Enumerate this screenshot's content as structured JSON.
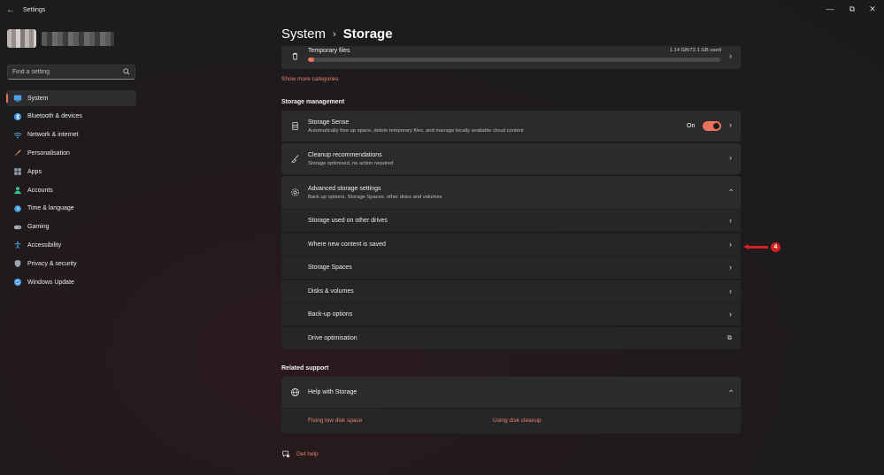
{
  "window": {
    "title": "Settings",
    "minimize": "—",
    "maximize": "⧉",
    "close": "✕"
  },
  "search": {
    "placeholder": "Find a setting"
  },
  "sidebar": {
    "items": [
      {
        "label": "System",
        "icon": "system-icon",
        "color": "#4aa3e8"
      },
      {
        "label": "Bluetooth & devices",
        "icon": "bluetooth-icon",
        "color": "#3b8ee0"
      },
      {
        "label": "Network & internet",
        "icon": "wifi-icon",
        "color": "#5aa8e6"
      },
      {
        "label": "Personalisation",
        "icon": "brush-icon",
        "color": "#e0a060"
      },
      {
        "label": "Apps",
        "icon": "apps-icon",
        "color": "#9aa3b0"
      },
      {
        "label": "Accounts",
        "icon": "person-icon",
        "color": "#3fc08a"
      },
      {
        "label": "Time & language",
        "icon": "globe-clock-icon",
        "color": "#4aa3e8"
      },
      {
        "label": "Gaming",
        "icon": "gamepad-icon",
        "color": "#aab0b8"
      },
      {
        "label": "Accessibility",
        "icon": "accessibility-icon",
        "color": "#4aa3e8"
      },
      {
        "label": "Privacy & security",
        "icon": "shield-icon",
        "color": "#9aa3b0"
      },
      {
        "label": "Windows Update",
        "icon": "update-icon",
        "color": "#3b8ee0"
      }
    ]
  },
  "breadcrumb": {
    "parent": "System",
    "separator": "›",
    "current": "Storage"
  },
  "temp_files": {
    "label": "Temporary files",
    "usage": "1.14 GB/72.1 GB used",
    "fill_fraction": 0.016,
    "bar_color": "#e8715b"
  },
  "show_more": "Show more categories",
  "storage_management": {
    "title": "Storage management",
    "storage_sense": {
      "title": "Storage Sense",
      "subtitle": "Automatically free up space, delete temporary files, and manage locally available cloud content",
      "toggle_label": "On",
      "toggle_on": true
    },
    "cleanup": {
      "title": "Cleanup recommendations",
      "subtitle": "Storage optimised, no action required"
    },
    "advanced": {
      "title": "Advanced storage settings",
      "subtitle": "Back up options, Storage Spaces, other disks and volumes",
      "items": [
        "Storage used on other drives",
        "Where new content is saved",
        "Storage Spaces",
        "Disks & volumes",
        "Back-up options",
        "Drive optimisation"
      ]
    }
  },
  "annotation": {
    "number": "4",
    "color": "#d42020"
  },
  "related_support": {
    "title": "Related support",
    "help": {
      "title": "Help with Storage",
      "links": [
        "Fixing low disk space",
        "Using disk cleanup"
      ]
    }
  },
  "get_help": "Get help",
  "accent_color": "#e8715b"
}
